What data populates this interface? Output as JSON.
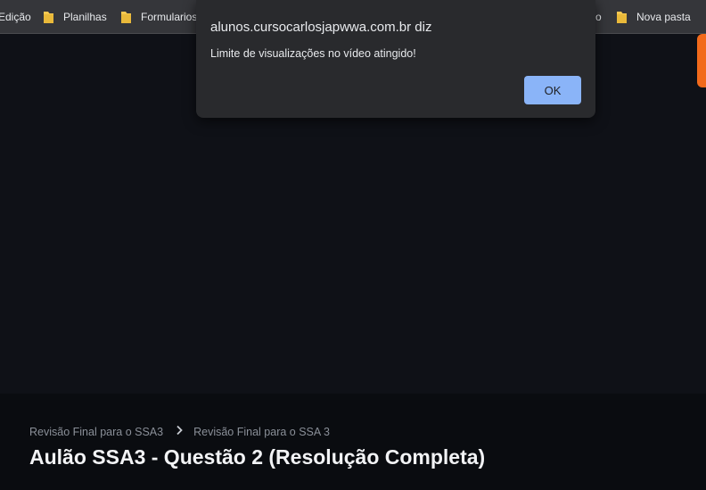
{
  "bookmarks": [
    {
      "label": "Edição",
      "icon": "folder-icon"
    },
    {
      "label": "Planilhas",
      "icon": "folder-icon"
    },
    {
      "label": "Formularios",
      "icon": "folder-icon"
    },
    {
      "label": "o",
      "icon": "folder-icon"
    },
    {
      "label": "Nova pasta",
      "icon": "folder-icon"
    }
  ],
  "dialog": {
    "title": "alunos.cursocarlosjapwwa.com.br diz",
    "message": "Limite de visualizações no vídeo atingido!",
    "ok_label": "OK"
  },
  "breadcrumb": {
    "items": [
      "Revisão Final para o SSA3",
      "Revisão Final para o SSA 3"
    ]
  },
  "lesson": {
    "title": "Aulão SSA3 - Questão 2 (Resolução Completa)"
  },
  "colors": {
    "accent_orange": "#f26a1b",
    "button_blue": "#8ab4f8",
    "folder_yellow": "#f5c851"
  }
}
